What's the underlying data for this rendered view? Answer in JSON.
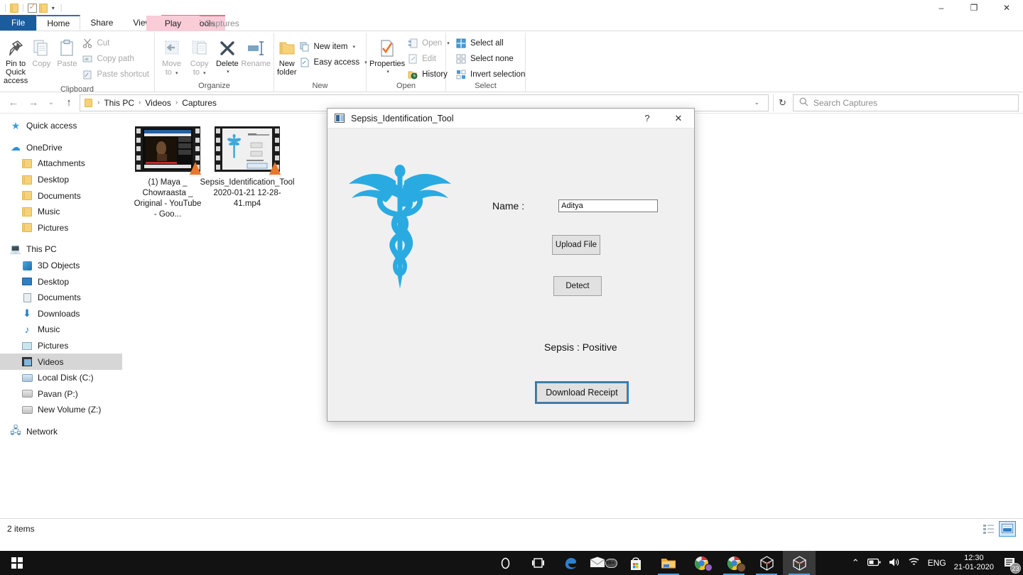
{
  "window": {
    "title_bar_tabs": [
      "File",
      "Home",
      "Share",
      "View"
    ],
    "contextual_header": "Play",
    "contextual_tab": "Video Tools",
    "contextual_title": "Captures",
    "minimize": "–",
    "maximize": "❐",
    "close": "✕",
    "collapse_ribbon": "⌃",
    "help": "?"
  },
  "ribbon": {
    "groups": [
      {
        "label": "Clipboard",
        "big_buttons": [
          {
            "name": "pin-to-quick-access",
            "label": "Pin to Quick\naccess",
            "line1": "Pin to Quick",
            "line2": "access"
          },
          {
            "name": "copy",
            "label": "Copy",
            "line1": "Copy",
            "line2": ""
          },
          {
            "name": "paste",
            "label": "Paste",
            "line1": "Paste",
            "line2": ""
          }
        ],
        "small_buttons": [
          "Cut",
          "Copy path",
          "Paste shortcut"
        ]
      },
      {
        "label": "Organize",
        "big_buttons": [
          {
            "name": "move-to",
            "line1": "Move",
            "line2": "to"
          },
          {
            "name": "copy-to",
            "line1": "Copy",
            "line2": "to"
          },
          {
            "name": "delete",
            "line1": "Delete",
            "line2": ""
          },
          {
            "name": "rename",
            "line1": "Rename",
            "line2": ""
          }
        ],
        "small_buttons": []
      },
      {
        "label": "New",
        "big_buttons": [
          {
            "name": "new-folder",
            "line1": "New",
            "line2": "folder"
          }
        ],
        "small_buttons": [
          "New item",
          "Easy access"
        ]
      },
      {
        "label": "Open",
        "big_buttons": [
          {
            "name": "properties",
            "line1": "Properties",
            "line2": ""
          }
        ],
        "small_buttons": [
          "Open",
          "Edit",
          "History"
        ]
      },
      {
        "label": "Select",
        "big_buttons": [],
        "small_buttons": [
          "Select all",
          "Select none",
          "Invert selection"
        ]
      }
    ]
  },
  "address": {
    "back": "←",
    "forward": "→",
    "recent": "⌄",
    "up": "↑",
    "crumbs": [
      "This PC",
      "Videos",
      "Captures"
    ],
    "separator": "›",
    "dropdown": "⌄",
    "refresh": "↻",
    "search_placeholder": "Search Captures",
    "search_value": "",
    "search_icon": "search-icon"
  },
  "sidebar": {
    "items": [
      {
        "label": "Quick access",
        "icon": "star-icon",
        "indent": false,
        "selected": false
      },
      {
        "label": "OneDrive",
        "icon": "cloud-icon",
        "indent": false,
        "selected": false,
        "space_before": true
      },
      {
        "label": "Attachments",
        "icon": "folder-icon",
        "indent": true,
        "selected": false
      },
      {
        "label": "Desktop",
        "icon": "folder-icon",
        "indent": true,
        "selected": false
      },
      {
        "label": "Documents",
        "icon": "folder-icon",
        "indent": true,
        "selected": false
      },
      {
        "label": "Music",
        "icon": "folder-icon",
        "indent": true,
        "selected": false
      },
      {
        "label": "Pictures",
        "icon": "folder-icon",
        "indent": true,
        "selected": false
      },
      {
        "label": "This PC",
        "icon": "pc-icon",
        "indent": false,
        "selected": false,
        "space_before": true
      },
      {
        "label": "3D Objects",
        "icon": "3d-objects-icon",
        "indent": true,
        "selected": false
      },
      {
        "label": "Desktop",
        "icon": "desktop-icon",
        "indent": true,
        "selected": false
      },
      {
        "label": "Documents",
        "icon": "documents-icon",
        "indent": true,
        "selected": false
      },
      {
        "label": "Downloads",
        "icon": "downloads-icon",
        "indent": true,
        "selected": false
      },
      {
        "label": "Music",
        "icon": "music-icon",
        "indent": true,
        "selected": false
      },
      {
        "label": "Pictures",
        "icon": "pictures-icon",
        "indent": true,
        "selected": false
      },
      {
        "label": "Videos",
        "icon": "videos-icon",
        "indent": true,
        "selected": true
      },
      {
        "label": "Local Disk (C:)",
        "icon": "local-disk-icon",
        "indent": true,
        "selected": false
      },
      {
        "label": "Pavan (P:)",
        "icon": "drive-icon",
        "indent": true,
        "selected": false
      },
      {
        "label": "New Volume (Z:)",
        "icon": "drive-icon",
        "indent": true,
        "selected": false
      },
      {
        "label": "Network",
        "icon": "network-icon",
        "indent": false,
        "selected": false,
        "space_before": true
      }
    ]
  },
  "files": [
    {
      "name": "(1) Maya _ Chowraasta _ Original - YouTube - Goo...",
      "type": "video",
      "thumb": "youtube-video-thumbnail"
    },
    {
      "name": "Sepsis_Identification_Tool 2020-01-21 12-28-41.mp4",
      "type": "video",
      "thumb": "sepsis-tool-recording-thumbnail"
    }
  ],
  "status": {
    "item_count": "2 items",
    "view_details_icon": "details-view-icon",
    "view_large_icons_icon": "large-icons-view-icon"
  },
  "dialog": {
    "title": "Sepsis_Identification_Tool",
    "help_button": "?",
    "close_button": "✕",
    "logo": "caduceus-icon",
    "name_label": "Name :",
    "name_value": "Aditya",
    "upload_button": "Upload File",
    "detect_button": "Detect",
    "result_text": "Sepsis : Positive",
    "download_button": "Download Receipt",
    "accent_color": "#29abe2",
    "focus_outline_color": "#1a7fd4"
  },
  "taskbar": {
    "start": "start-button",
    "icons": [
      {
        "name": "cortana-icon",
        "glyph": "◯",
        "running": false,
        "active": false
      },
      {
        "name": "task-view-icon",
        "glyph": "❑",
        "running": false,
        "active": false
      },
      {
        "name": "edge-icon",
        "glyph": "e",
        "running": false,
        "active": false
      },
      {
        "name": "mail-icon",
        "glyph": "✉",
        "badge": "99+",
        "running": false,
        "active": false
      },
      {
        "name": "microsoft-store-icon",
        "glyph": "🛍",
        "running": false,
        "active": false
      },
      {
        "name": "file-explorer-icon",
        "glyph": "🗂",
        "running": true,
        "active": false
      },
      {
        "name": "chrome-icon",
        "glyph": "◉",
        "running": false,
        "active": false
      },
      {
        "name": "chrome-profile-icon",
        "glyph": "◉",
        "running": true,
        "active": false
      },
      {
        "name": "spyder-icon",
        "glyph": "✺",
        "running": true,
        "active": false
      },
      {
        "name": "spyder-active-icon",
        "glyph": "✺",
        "running": true,
        "active": true
      }
    ],
    "tray": {
      "show_hidden": "⌃",
      "battery": "battery-icon",
      "volume": "volume-icon",
      "wifi": "wifi-icon",
      "language": "ENG",
      "time": "12:30",
      "date": "21-01-2020",
      "notifications_badge": "23"
    }
  }
}
